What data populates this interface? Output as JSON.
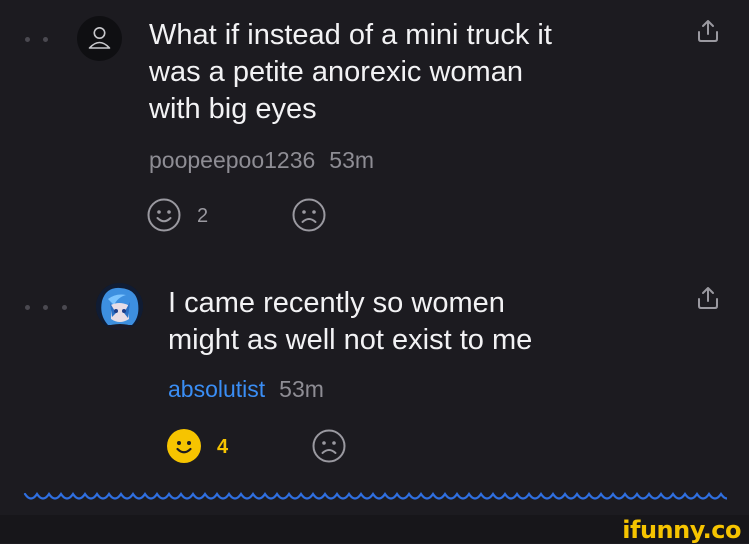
{
  "comments": [
    {
      "text": "What if instead of a mini truck it\nwas a petite anorexic woman\nwith big eyes",
      "username": "poopeepoo1236",
      "time": "53m",
      "like_count": "2"
    },
    {
      "text": "I came recently so women\nmight as well not exist to me",
      "username": "absolutist",
      "time": "53m",
      "like_count": "4"
    }
  ],
  "watermark": "ifunny.co",
  "colors": {
    "background": "#1c1b20",
    "text": "#f2f2f4",
    "muted": "#8e8d94",
    "link_blue": "#3a8ef5",
    "active_yellow": "#f6c400"
  },
  "icons": [
    "user-icon",
    "share-icon",
    "smile-icon",
    "frown-icon",
    "wave-divider"
  ]
}
